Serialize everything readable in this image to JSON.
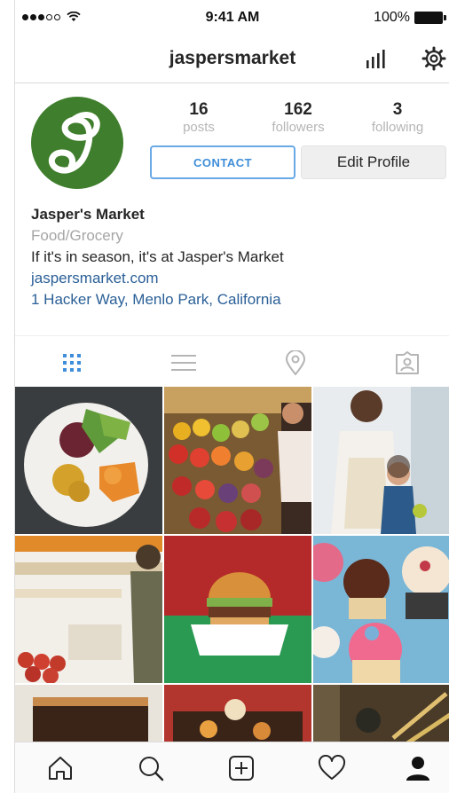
{
  "status_bar": {
    "time": "9:41 AM",
    "battery": "100%",
    "signal_strength": "3 of 5"
  },
  "nav": {
    "title": "jaspersmarket",
    "icons": [
      "stats-icon",
      "gear-icon"
    ]
  },
  "profile": {
    "avatar_icon": "jaspers-market-logo",
    "stats": [
      {
        "num": "16",
        "label": "posts"
      },
      {
        "num": "162",
        "label": "followers"
      },
      {
        "num": "3",
        "label": "following"
      }
    ],
    "contact_label": "CONTACT",
    "edit_label": "Edit Profile"
  },
  "bio": {
    "name": "Jasper's Market",
    "category": "Food/Grocery",
    "text": "If it's in season, it's at Jasper's Market",
    "link": "jaspersmarket.com",
    "address": "1 Hacker Way, Menlo Park, California"
  },
  "tabs": [
    {
      "name": "grid-view-icon",
      "active": true
    },
    {
      "name": "list-view-icon",
      "active": false
    },
    {
      "name": "location-pin-icon",
      "active": false
    },
    {
      "name": "tagged-photos-icon",
      "active": false
    }
  ],
  "posts": [
    {
      "subject": "salad-bowl-photo"
    },
    {
      "subject": "produce-market-photo"
    },
    {
      "subject": "mother-daughter-shopping-photo"
    },
    {
      "subject": "market-shelves-photo"
    },
    {
      "subject": "burger-photo"
    },
    {
      "subject": "cupcakes-photo"
    },
    {
      "subject": "bread-photo"
    },
    {
      "subject": "food-tray-photo"
    },
    {
      "subject": "wheat-stalks-photo"
    }
  ],
  "bottom_nav": [
    "home-icon",
    "search-icon",
    "add-post-icon",
    "heart-icon",
    "profile-icon"
  ],
  "colors": {
    "accent_blue": "#3f8ed9",
    "link_blue": "#2a5f97",
    "avatar_green": "#3f7e2c",
    "muted_gray": "#b5b5b5"
  }
}
